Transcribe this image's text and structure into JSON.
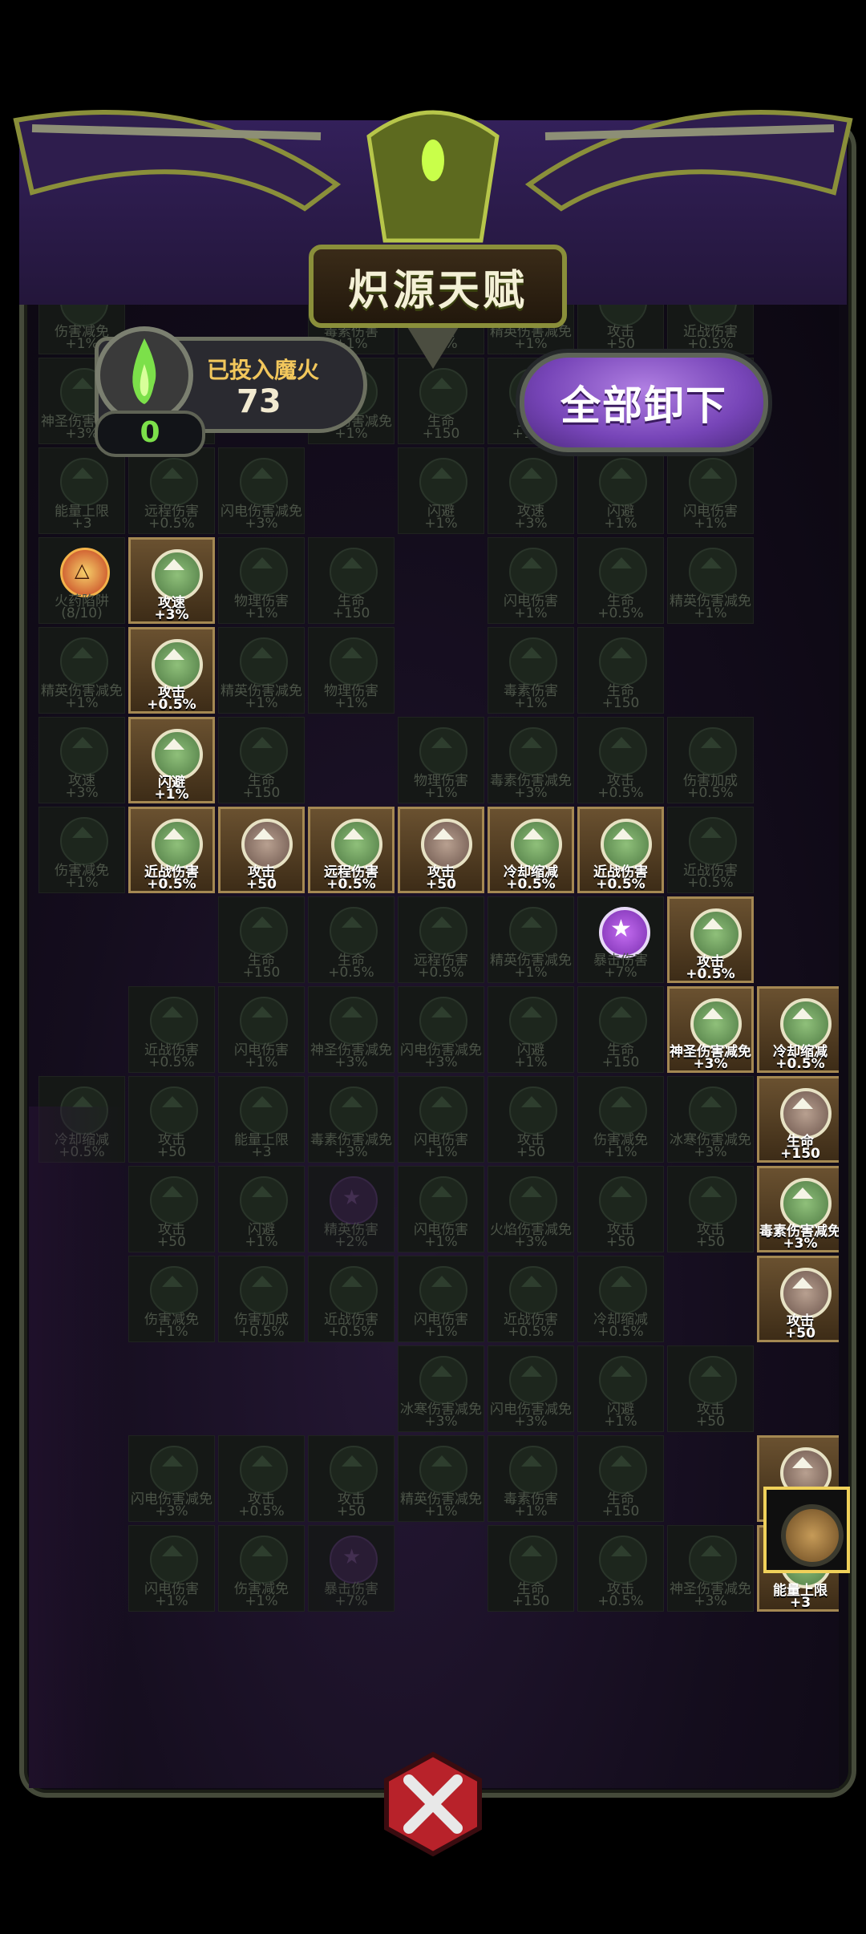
{
  "title": "炽源天赋",
  "fire": {
    "label": "已投入魔火",
    "invested": "73",
    "available": "0"
  },
  "buttons": {
    "unequip_all": "全部卸下"
  },
  "colors": {
    "header": "#2a1a46",
    "button": "#8a54c8",
    "active_frame": "#a48852",
    "flame": "#7ce04a"
  },
  "nodes": [
    {
      "c": 0,
      "r": 0,
      "name": "伤害减免",
      "val": "+1%",
      "s": "dim"
    },
    {
      "c": 3,
      "r": 0,
      "name": "毒素伤害",
      "val": "+1%",
      "s": "dim"
    },
    {
      "c": 4,
      "r": 0,
      "name": "攻速",
      "val": "+3%",
      "s": "dim"
    },
    {
      "c": 5,
      "r": 0,
      "name": "精英伤害减免",
      "val": "+1%",
      "s": "dim"
    },
    {
      "c": 6,
      "r": 0,
      "name": "攻击",
      "val": "+50",
      "s": "dim"
    },
    {
      "c": 7,
      "r": 0,
      "name": "近战伤害",
      "val": "+0.5%",
      "s": "dim"
    },
    {
      "c": 0,
      "r": 1,
      "name": "神圣伤害减免",
      "val": "+3%",
      "s": "dim"
    },
    {
      "c": 1,
      "r": 1,
      "name": "伤害减免",
      "val": "+1%",
      "s": "dim"
    },
    {
      "c": 3,
      "r": 1,
      "name": "精英伤害减免",
      "val": "+1%",
      "s": "dim"
    },
    {
      "c": 4,
      "r": 1,
      "name": "生命",
      "val": "+150",
      "s": "dim"
    },
    {
      "c": 5,
      "r": 1,
      "name": "生命",
      "val": "+150",
      "s": "dim"
    },
    {
      "c": 6,
      "r": 1,
      "name": "闪电伤害减免",
      "val": "+3%",
      "s": "dim"
    },
    {
      "c": 7,
      "r": 1,
      "name": "物理伤害",
      "val": "+1%",
      "s": "dim"
    },
    {
      "c": 0,
      "r": 2,
      "name": "能量上限",
      "val": "+3",
      "s": "dim"
    },
    {
      "c": 1,
      "r": 2,
      "name": "远程伤害",
      "val": "+0.5%",
      "s": "dim"
    },
    {
      "c": 2,
      "r": 2,
      "name": "闪电伤害减免",
      "val": "+3%",
      "s": "dim"
    },
    {
      "c": 4,
      "r": 2,
      "name": "闪避",
      "val": "+1%",
      "s": "dim"
    },
    {
      "c": 5,
      "r": 2,
      "name": "攻速",
      "val": "+3%",
      "s": "dim"
    },
    {
      "c": 6,
      "r": 2,
      "name": "闪避",
      "val": "+1%",
      "s": "dim"
    },
    {
      "c": 7,
      "r": 2,
      "name": "闪电伤害",
      "val": "+1%",
      "s": "dim"
    },
    {
      "c": 0,
      "r": 3,
      "name": "火药陷阱",
      "val": "(8/10)",
      "s": "special"
    },
    {
      "c": 1,
      "r": 3,
      "name": "攻速",
      "val": "+3%",
      "s": "active"
    },
    {
      "c": 2,
      "r": 3,
      "name": "物理伤害",
      "val": "+1%",
      "s": "dim"
    },
    {
      "c": 3,
      "r": 3,
      "name": "生命",
      "val": "+150",
      "s": "dim"
    },
    {
      "c": 5,
      "r": 3,
      "name": "闪电伤害",
      "val": "+1%",
      "s": "dim"
    },
    {
      "c": 6,
      "r": 3,
      "name": "生命",
      "val": "+0.5%",
      "s": "dim"
    },
    {
      "c": 7,
      "r": 3,
      "name": "精英伤害减免",
      "val": "+1%",
      "s": "dim"
    },
    {
      "c": 0,
      "r": 4,
      "name": "精英伤害减免",
      "val": "+1%",
      "s": "dim"
    },
    {
      "c": 1,
      "r": 4,
      "name": "攻击",
      "val": "+0.5%",
      "s": "active"
    },
    {
      "c": 2,
      "r": 4,
      "name": "精英伤害减免",
      "val": "+1%",
      "s": "dim"
    },
    {
      "c": 3,
      "r": 4,
      "name": "物理伤害",
      "val": "+1%",
      "s": "dim"
    },
    {
      "c": 5,
      "r": 4,
      "name": "毒素伤害",
      "val": "+1%",
      "s": "dim"
    },
    {
      "c": 6,
      "r": 4,
      "name": "生命",
      "val": "+150",
      "s": "dim"
    },
    {
      "c": 0,
      "r": 5,
      "name": "攻速",
      "val": "+3%",
      "s": "dim"
    },
    {
      "c": 1,
      "r": 5,
      "name": "闪避",
      "val": "+1%",
      "s": "active"
    },
    {
      "c": 2,
      "r": 5,
      "name": "生命",
      "val": "+150",
      "s": "dim"
    },
    {
      "c": 4,
      "r": 5,
      "name": "物理伤害",
      "val": "+1%",
      "s": "dim"
    },
    {
      "c": 5,
      "r": 5,
      "name": "毒素伤害减免",
      "val": "+3%",
      "s": "dim"
    },
    {
      "c": 6,
      "r": 5,
      "name": "攻击",
      "val": "+0.5%",
      "s": "dim"
    },
    {
      "c": 7,
      "r": 5,
      "name": "伤害加成",
      "val": "+0.5%",
      "s": "dim"
    },
    {
      "c": 0,
      "r": 6,
      "name": "伤害减免",
      "val": "+1%",
      "s": "dim"
    },
    {
      "c": 1,
      "r": 6,
      "name": "近战伤害",
      "val": "+0.5%",
      "s": "active"
    },
    {
      "c": 2,
      "r": 6,
      "name": "攻击",
      "val": "+50",
      "s": "active brown"
    },
    {
      "c": 3,
      "r": 6,
      "name": "远程伤害",
      "val": "+0.5%",
      "s": "active"
    },
    {
      "c": 4,
      "r": 6,
      "name": "攻击",
      "val": "+50",
      "s": "active brown"
    },
    {
      "c": 5,
      "r": 6,
      "name": "冷却缩减",
      "val": "+0.5%",
      "s": "active"
    },
    {
      "c": 6,
      "r": 6,
      "name": "近战伤害",
      "val": "+0.5%",
      "s": "active"
    },
    {
      "c": 7,
      "r": 6,
      "name": "近战伤害",
      "val": "+0.5%",
      "s": "dim"
    },
    {
      "c": 2,
      "r": 7,
      "name": "生命",
      "val": "+150",
      "s": "dim"
    },
    {
      "c": 3,
      "r": 7,
      "name": "生命",
      "val": "+0.5%",
      "s": "dim"
    },
    {
      "c": 4,
      "r": 7,
      "name": "远程伤害",
      "val": "+0.5%",
      "s": "dim"
    },
    {
      "c": 5,
      "r": 7,
      "name": "精英伤害减免",
      "val": "+1%",
      "s": "dim"
    },
    {
      "c": 6,
      "r": 7,
      "name": "暴击伤害",
      "val": "+7%",
      "s": "crit"
    },
    {
      "c": 7,
      "r": 7,
      "name": "攻击",
      "val": "+0.5%",
      "s": "active"
    },
    {
      "c": 1,
      "r": 8,
      "name": "近战伤害",
      "val": "+0.5%",
      "s": "dim"
    },
    {
      "c": 2,
      "r": 8,
      "name": "闪电伤害",
      "val": "+1%",
      "s": "dim"
    },
    {
      "c": 3,
      "r": 8,
      "name": "神圣伤害减免",
      "val": "+3%",
      "s": "dim"
    },
    {
      "c": 4,
      "r": 8,
      "name": "闪电伤害减免",
      "val": "+3%",
      "s": "dim"
    },
    {
      "c": 5,
      "r": 8,
      "name": "闪避",
      "val": "+1%",
      "s": "dim"
    },
    {
      "c": 6,
      "r": 8,
      "name": "生命",
      "val": "+150",
      "s": "dim"
    },
    {
      "c": 7,
      "r": 8,
      "name": "神圣伤害减免",
      "val": "+3%",
      "s": "active"
    },
    {
      "c": 8,
      "r": 8,
      "name": "冷却缩减",
      "val": "+0.5%",
      "s": "active"
    },
    {
      "c": 0,
      "r": 9,
      "name": "冷却缩减",
      "val": "+0.5%",
      "s": "dim"
    },
    {
      "c": 1,
      "r": 9,
      "name": "攻击",
      "val": "+50",
      "s": "dim"
    },
    {
      "c": 2,
      "r": 9,
      "name": "能量上限",
      "val": "+3",
      "s": "dim"
    },
    {
      "c": 3,
      "r": 9,
      "name": "毒素伤害减免",
      "val": "+3%",
      "s": "dim"
    },
    {
      "c": 4,
      "r": 9,
      "name": "闪电伤害",
      "val": "+1%",
      "s": "dim"
    },
    {
      "c": 5,
      "r": 9,
      "name": "攻击",
      "val": "+50",
      "s": "dim"
    },
    {
      "c": 6,
      "r": 9,
      "name": "伤害减免",
      "val": "+1%",
      "s": "dim"
    },
    {
      "c": 7,
      "r": 9,
      "name": "冰寒伤害减免",
      "val": "+3%",
      "s": "dim"
    },
    {
      "c": 8,
      "r": 9,
      "name": "生命",
      "val": "+150",
      "s": "active brown"
    },
    {
      "c": 1,
      "r": 10,
      "name": "攻击",
      "val": "+50",
      "s": "dim"
    },
    {
      "c": 2,
      "r": 10,
      "name": "闪避",
      "val": "+1%",
      "s": "dim"
    },
    {
      "c": 3,
      "r": 10,
      "name": "精英伤害",
      "val": "+2%",
      "s": "locked"
    },
    {
      "c": 4,
      "r": 10,
      "name": "闪电伤害",
      "val": "+1%",
      "s": "dim"
    },
    {
      "c": 5,
      "r": 10,
      "name": "火焰伤害减免",
      "val": "+3%",
      "s": "dim"
    },
    {
      "c": 6,
      "r": 10,
      "name": "攻击",
      "val": "+50",
      "s": "dim"
    },
    {
      "c": 7,
      "r": 10,
      "name": "攻击",
      "val": "+50",
      "s": "dim"
    },
    {
      "c": 8,
      "r": 10,
      "name": "毒素伤害减免",
      "val": "+3%",
      "s": "active"
    },
    {
      "c": 1,
      "r": 11,
      "name": "伤害减免",
      "val": "+1%",
      "s": "dim"
    },
    {
      "c": 2,
      "r": 11,
      "name": "伤害加成",
      "val": "+0.5%",
      "s": "dim"
    },
    {
      "c": 3,
      "r": 11,
      "name": "近战伤害",
      "val": "+0.5%",
      "s": "dim"
    },
    {
      "c": 4,
      "r": 11,
      "name": "闪电伤害",
      "val": "+1%",
      "s": "dim"
    },
    {
      "c": 5,
      "r": 11,
      "name": "近战伤害",
      "val": "+0.5%",
      "s": "dim"
    },
    {
      "c": 6,
      "r": 11,
      "name": "冷却缩减",
      "val": "+0.5%",
      "s": "dim"
    },
    {
      "c": 8,
      "r": 11,
      "name": "攻击",
      "val": "+50",
      "s": "active brown"
    },
    {
      "c": 4,
      "r": 12,
      "name": "冰寒伤害减免",
      "val": "+3%",
      "s": "dim"
    },
    {
      "c": 5,
      "r": 12,
      "name": "闪电伤害减免",
      "val": "+3%",
      "s": "dim"
    },
    {
      "c": 6,
      "r": 12,
      "name": "闪避",
      "val": "+1%",
      "s": "dim"
    },
    {
      "c": 7,
      "r": 12,
      "name": "攻击",
      "val": "+50",
      "s": "dim"
    },
    {
      "c": 1,
      "r": 13,
      "name": "闪电伤害减免",
      "val": "+3%",
      "s": "dim"
    },
    {
      "c": 2,
      "r": 13,
      "name": "攻击",
      "val": "+0.5%",
      "s": "dim"
    },
    {
      "c": 3,
      "r": 13,
      "name": "攻击",
      "val": "+50",
      "s": "dim"
    },
    {
      "c": 4,
      "r": 13,
      "name": "精英伤害减免",
      "val": "+1%",
      "s": "dim"
    },
    {
      "c": 5,
      "r": 13,
      "name": "毒素伤害",
      "val": "+1%",
      "s": "dim"
    },
    {
      "c": 6,
      "r": 13,
      "name": "生命",
      "val": "+150",
      "s": "dim"
    },
    {
      "c": 8,
      "r": 13,
      "name": "攻击",
      "val": "+50",
      "s": "active brown"
    },
    {
      "c": 1,
      "r": 14,
      "name": "闪电伤害",
      "val": "+1%",
      "s": "dim"
    },
    {
      "c": 2,
      "r": 14,
      "name": "伤害减免",
      "val": "+1%",
      "s": "dim"
    },
    {
      "c": 3,
      "r": 14,
      "name": "暴击伤害",
      "val": "+7%",
      "s": "locked"
    },
    {
      "c": 5,
      "r": 14,
      "name": "生命",
      "val": "+150",
      "s": "dim"
    },
    {
      "c": 6,
      "r": 14,
      "name": "攻击",
      "val": "+0.5%",
      "s": "dim"
    },
    {
      "c": 7,
      "r": 14,
      "name": "神圣伤害减免",
      "val": "+3%",
      "s": "dim"
    },
    {
      "c": 8,
      "r": 14,
      "name": "能量上限",
      "val": "+3",
      "s": "active"
    }
  ]
}
